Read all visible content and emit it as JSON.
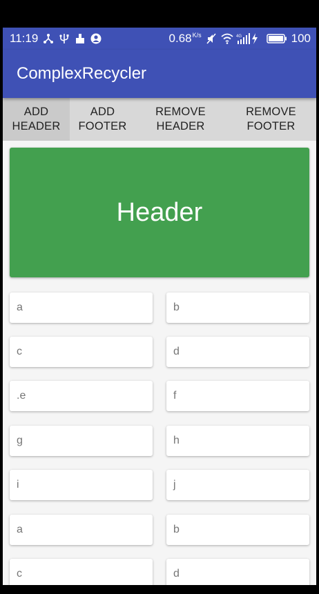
{
  "status_bar": {
    "time": "11:19",
    "net_speed": "0.68",
    "net_speed_unit": "K/s",
    "battery": "100",
    "icons_left": [
      "share-icon",
      "usb-icon",
      "cleaner-icon",
      "account-icon"
    ],
    "icons_right": [
      "mute-icon",
      "wifi-icon",
      "signal-4g-icon",
      "charging-icon",
      "battery-icon"
    ]
  },
  "app_bar": {
    "title": "ComplexRecycler",
    "color": "#3f51b5"
  },
  "toolbar": {
    "add_header": "ADD\nHEADER",
    "add_footer": "ADD\nFOOTER",
    "remove_header": "REMOVE\nHEADER",
    "remove_footer": "REMOVE\nFOOTER"
  },
  "header": {
    "label": "Header",
    "color": "#43a04f"
  },
  "items": [
    {
      "label": "a"
    },
    {
      "label": "b"
    },
    {
      "label": "c"
    },
    {
      "label": "d"
    },
    {
      "label": ".e"
    },
    {
      "label": "f"
    },
    {
      "label": "g"
    },
    {
      "label": "h"
    },
    {
      "label": "i"
    },
    {
      "label": "j"
    },
    {
      "label": "a"
    },
    {
      "label": "b"
    },
    {
      "label": "c"
    },
    {
      "label": "d"
    }
  ]
}
